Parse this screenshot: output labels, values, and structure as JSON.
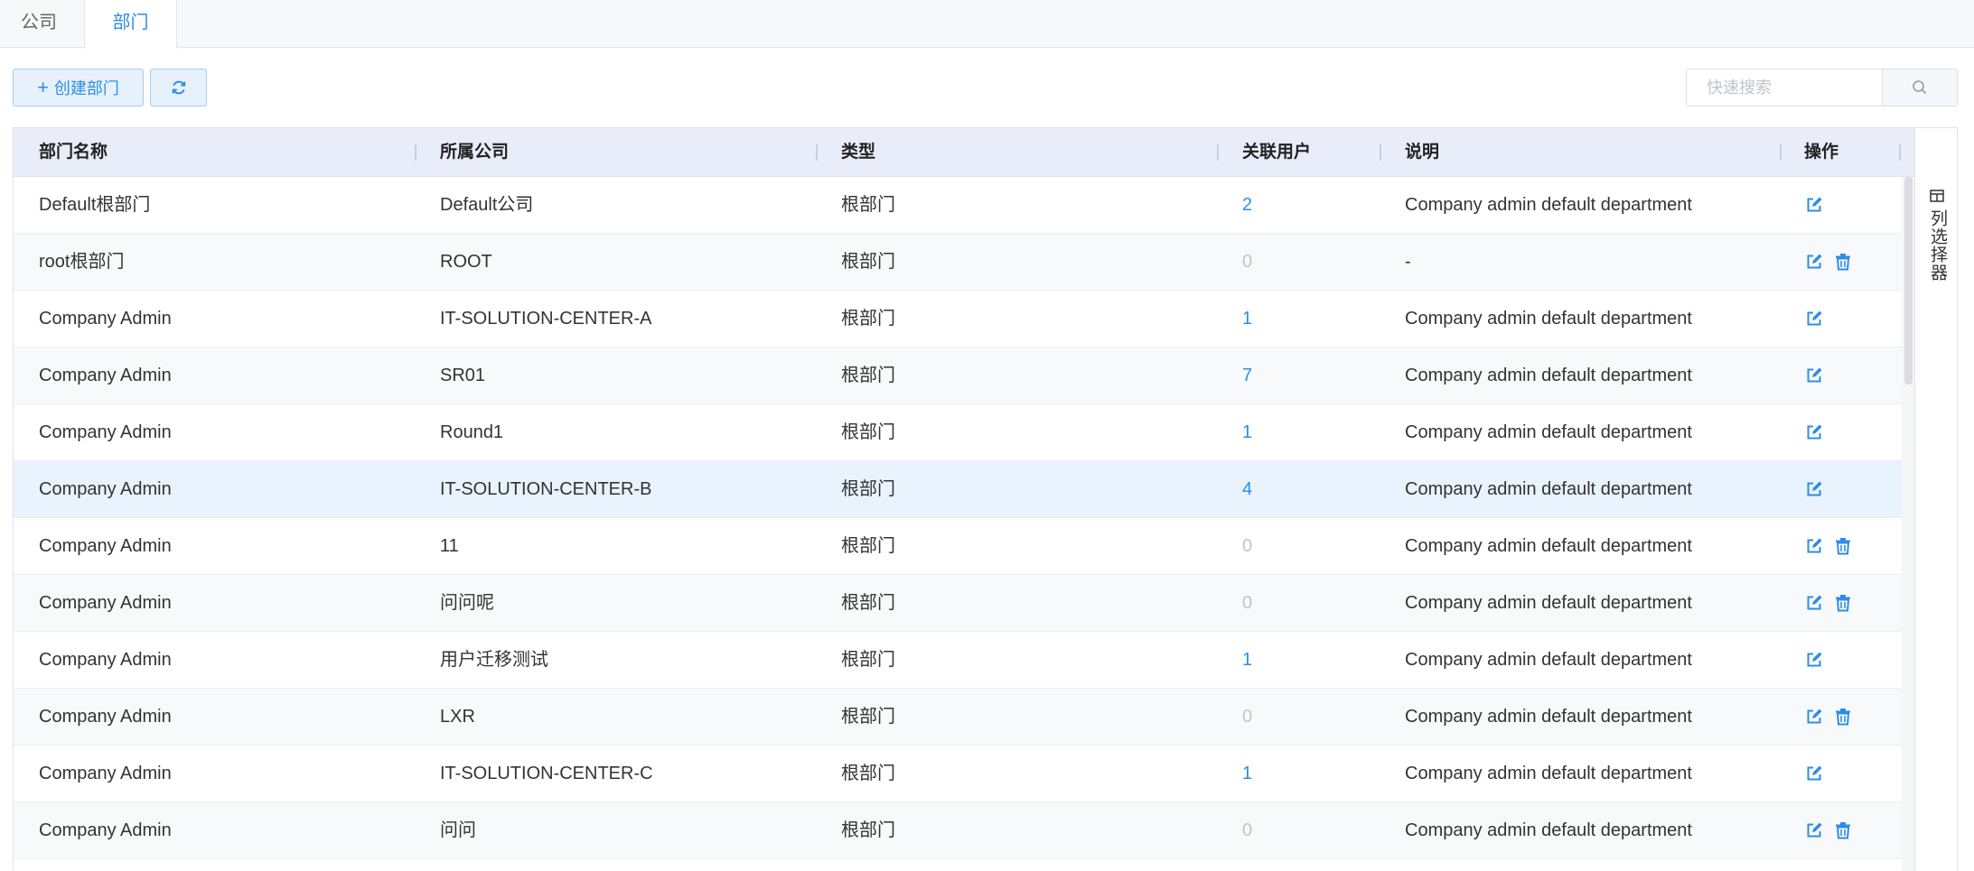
{
  "tabs": [
    {
      "label": "公司"
    },
    {
      "label": "部门"
    }
  ],
  "toolbar": {
    "create_label": "创建部门",
    "search_placeholder": "快速搜索",
    "refresh_icon": "refresh-icon",
    "search_icon": "search-icon"
  },
  "columns": [
    "部门名称",
    "所属公司",
    "类型",
    "关联用户",
    "说明",
    "操作"
  ],
  "rows": [
    {
      "name": "Default根部门",
      "company": "Default公司",
      "type": "根部门",
      "users": "2",
      "desc": "Company admin default department",
      "deletable": false
    },
    {
      "name": "root根部门",
      "company": "ROOT",
      "type": "根部门",
      "users": "0",
      "desc": "-",
      "deletable": true
    },
    {
      "name": "Company Admin",
      "company": "IT-SOLUTION-CENTER-A",
      "type": "根部门",
      "users": "1",
      "desc": "Company admin default department",
      "deletable": false
    },
    {
      "name": "Company Admin",
      "company": "SR01",
      "type": "根部门",
      "users": "7",
      "desc": "Company admin default department",
      "deletable": false
    },
    {
      "name": "Company Admin",
      "company": "Round1",
      "type": "根部门",
      "users": "1",
      "desc": "Company admin default department",
      "deletable": false
    },
    {
      "name": "Company Admin",
      "company": "IT-SOLUTION-CENTER-B",
      "type": "根部门",
      "users": "4",
      "desc": "Company admin default department",
      "deletable": false
    },
    {
      "name": "Company Admin",
      "company": "11",
      "type": "根部门",
      "users": "0",
      "desc": "Company admin default department",
      "deletable": true
    },
    {
      "name": "Company Admin",
      "company": "问问呢",
      "type": "根部门",
      "users": "0",
      "desc": "Company admin default department",
      "deletable": true
    },
    {
      "name": "Company Admin",
      "company": "用户迁移测试",
      "type": "根部门",
      "users": "1",
      "desc": "Company admin default department",
      "deletable": false
    },
    {
      "name": "Company Admin",
      "company": "LXR",
      "type": "根部门",
      "users": "0",
      "desc": "Company admin default department",
      "deletable": true
    },
    {
      "name": "Company Admin",
      "company": "IT-SOLUTION-CENTER-C",
      "type": "根部门",
      "users": "1",
      "desc": "Company admin default department",
      "deletable": false
    },
    {
      "name": "Company Admin",
      "company": "问问",
      "type": "根部门",
      "users": "0",
      "desc": "Company admin default department",
      "deletable": true
    }
  ],
  "column_selector": {
    "label": "列选择器",
    "icon": "columns-icon"
  },
  "colors": {
    "accent": "#2f8de4",
    "header_bg": "#e8edf9",
    "highlight_row": "#e8f3fd",
    "muted": "#c0c4cc"
  }
}
